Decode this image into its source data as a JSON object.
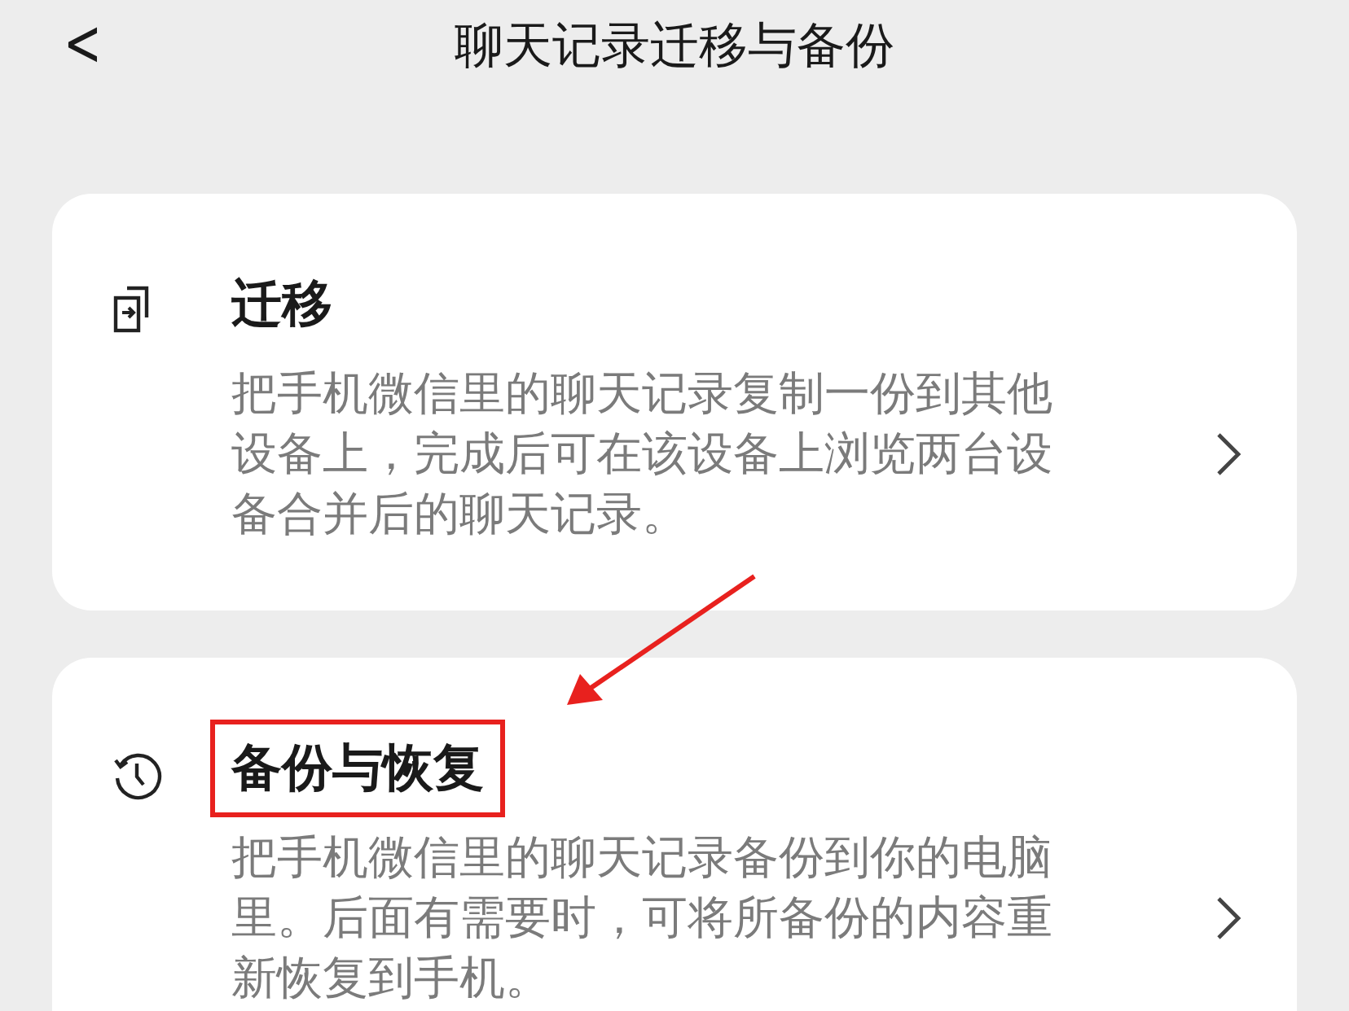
{
  "header": {
    "back_symbol": "<",
    "title": "聊天记录迁移与备份"
  },
  "cards": [
    {
      "kind": "transfer",
      "title": "迁移",
      "description": "把手机微信里的聊天记录复制一份到其他设备上，完成后可在该设备上浏览两台设备合并后的聊天记录。",
      "highlighted": false
    },
    {
      "kind": "backup",
      "title": "备份与恢复",
      "description": "把手机微信里的聊天记录备份到你的电脑里。后面有需要时，可将所备份的内容重新恢复到手机。",
      "highlighted": true
    }
  ]
}
